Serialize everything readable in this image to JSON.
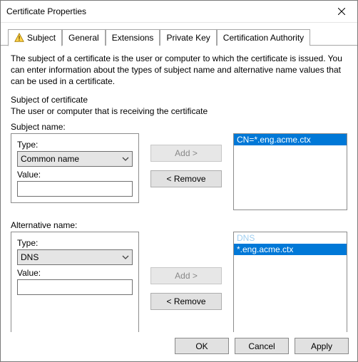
{
  "window": {
    "title": "Certificate Properties"
  },
  "tabs": {
    "items": [
      {
        "label": "Subject"
      },
      {
        "label": "General"
      },
      {
        "label": "Extensions"
      },
      {
        "label": "Private Key"
      },
      {
        "label": "Certification Authority"
      }
    ]
  },
  "subject": {
    "description": "The subject of a certificate is the user or computer to which the certificate is issued. You can enter information about the types of subject name and alternative name values that can be used in a certificate.",
    "heading": "Subject of certificate",
    "subheading": "The user or computer that is receiving the certificate",
    "name_section_label": "Subject name:",
    "type_label": "Type:",
    "value_label": "Value:",
    "type_selected": "Common name",
    "add_label": "Add >",
    "remove_label": "< Remove",
    "list_items": [
      "CN=*.eng.acme.ctx"
    ]
  },
  "altname": {
    "section_label": "Alternative name:",
    "type_label": "Type:",
    "value_label": "Value:",
    "type_selected": "DNS",
    "add_label": "Add >",
    "remove_label": "< Remove",
    "list_header": "DNS",
    "list_items": [
      "*.eng.acme.ctx"
    ]
  },
  "footer": {
    "ok": "OK",
    "cancel": "Cancel",
    "apply": "Apply"
  }
}
